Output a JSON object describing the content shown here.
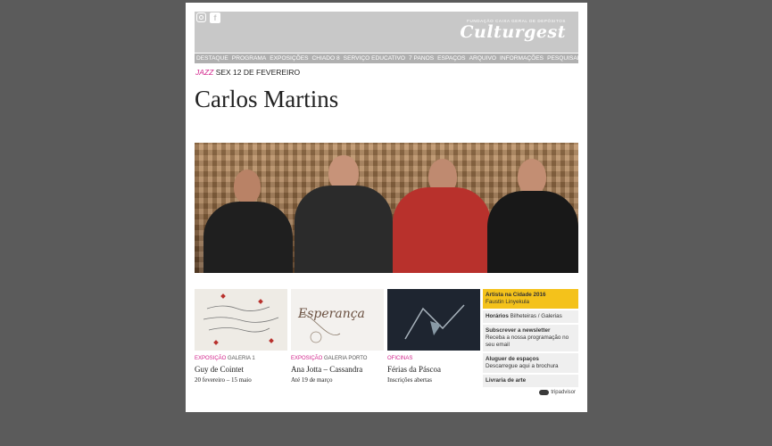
{
  "header": {
    "foundation": "FUNDAÇÃO CAIXA GERAL DE DEPÓSITOS",
    "logo": "Culturgest",
    "social": [
      {
        "icon": "instagram-icon",
        "label": ""
      },
      {
        "icon": "facebook-icon",
        "label": "f"
      }
    ]
  },
  "nav": {
    "items": [
      "DESTAQUE",
      "PROGRAMA",
      "EXPOSIÇÕES",
      "CHIADO 8",
      "SERVIÇO EDUCATIVO",
      "7 PANOS",
      "ESPAÇOS",
      "ARQUIVO",
      "INFORMAÇÕES",
      "PESQUISAR"
    ]
  },
  "event": {
    "category": "JAZZ",
    "date": "SEX 12 DE FEVEREIRO",
    "title": "Carlos Martins"
  },
  "cards": [
    {
      "kind": "EXPOSIÇÃO",
      "place": "GALERIA 1",
      "title": "Guy de Cointet",
      "detail": "20 fevereiro – 15 maio"
    },
    {
      "kind": "EXPOSIÇÃO",
      "place": "GALERIA PORTO",
      "title": "Ana Jotta – Cassandra",
      "detail": "Até 19 de março",
      "image_text": "Esperança"
    },
    {
      "kind": "OFICINAS",
      "place": "",
      "title": "Férias da Páscoa",
      "detail": "Inscrições abertas"
    }
  ],
  "sidebar": [
    {
      "title": "Artista na Cidade 2016",
      "text": "Faustin Linyekula"
    },
    {
      "title": "Horários",
      "text": "Bilheteiras / Galerias"
    },
    {
      "title": "Subscrever a newsletter",
      "text": "Receba a nossa programação no seu email"
    },
    {
      "title": "Aluguer de espaços",
      "text": "Descarregue aqui a brochura"
    },
    {
      "title": "Livraria de arte",
      "text": ""
    }
  ],
  "tripadvisor": "tripadvisor",
  "colors": {
    "accent": "#d2238b",
    "highlight": "#f4c21b",
    "header": "#c8c8c8",
    "backdrop": "#5b5b5b"
  }
}
